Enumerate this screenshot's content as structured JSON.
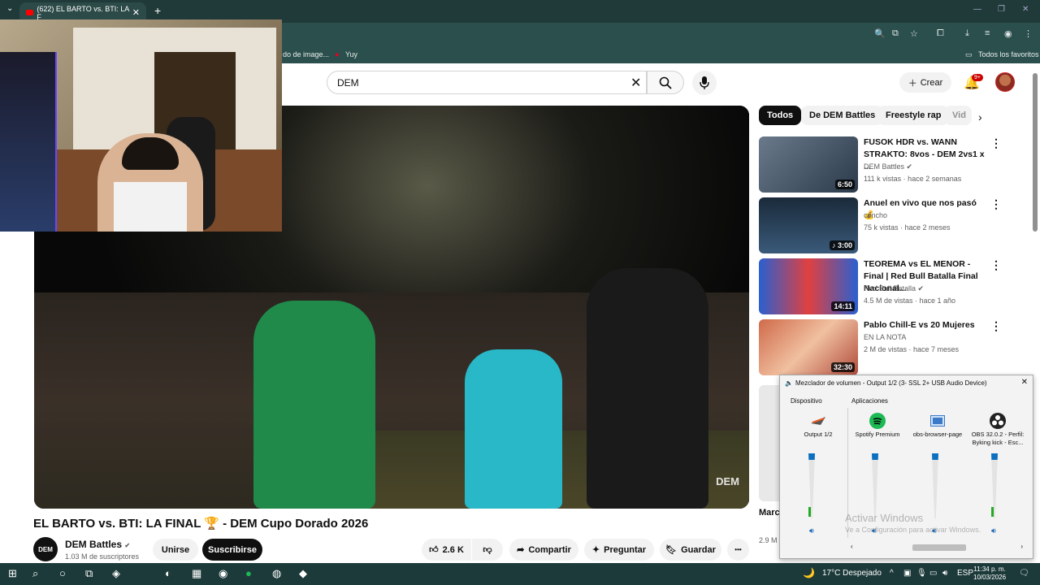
{
  "browser": {
    "tab_title": "(622) EL BARTO vs. BTI: LA F",
    "tab_close": "✕",
    "new_tab": "+",
    "bookmarks": [
      {
        "label": "do de image..."
      },
      {
        "label": "Yuy"
      }
    ],
    "all_bookmarks": "Todos los favoritos"
  },
  "youtube": {
    "search_value": "DEM",
    "search_clear": "✕",
    "create_label": "Crear",
    "notif_count": "9+",
    "video_title": "EL BARTO vs. BTI: LA FINAL 🏆 - DEM Cupo Dorado 2026",
    "video_watermark": "DEM",
    "channel": {
      "avatar_text": "DEM",
      "name": "DEM Battles",
      "verified": "✔",
      "subs": "1.03 M de suscriptores",
      "join_label": "Unirse",
      "subscribe_label": "Suscribirse"
    },
    "actions": {
      "likes": "2.6 K",
      "share": "Compartir",
      "ask": "Preguntar",
      "save": "Guardar",
      "more": "•••"
    },
    "chips": [
      {
        "label": "Todos"
      },
      {
        "label": "De DEM Battles"
      },
      {
        "label": "Freestyle rap"
      },
      {
        "label": "Vid"
      }
    ],
    "recommendations": [
      {
        "title": "FUSOK HDR vs. WANN STRAKTO: 8vos - DEM 2vs1 x ...",
        "channel": "DEM Battles ✔",
        "meta": "111 k vistas · hace 2 semanas",
        "duration": "6:50",
        "thumb_color": "#3a4a5a"
      },
      {
        "title": "Anuel en vivo que nos pasó 💰",
        "channel": "concho",
        "meta": "75 k vistas · hace 2 meses",
        "duration": "♪ 3:00",
        "thumb_color": "#2a3a4a"
      },
      {
        "title": "TEOREMA vs EL MENOR - Final | Red Bull Batalla Final Nacional...",
        "channel": "Red Bull Batalla ✔",
        "meta": "4.5 M de vistas · hace 1 año",
        "duration": "14:11",
        "thumb_color": "#3060c0"
      },
      {
        "title": "Pablo Chill-E vs 20 Mujeres",
        "channel": "EN LA NOTA",
        "meta": "2 M de vistas · hace 7 meses",
        "duration": "32:30",
        "thumb_color": "#c05a40"
      }
    ],
    "partial_title": "Marc v/s ...",
    "partial_views": "2.9 M"
  },
  "mixer": {
    "title": "Mezclador de volumen - Output 1/2 (3- SSL 2+ USB Audio Device)",
    "device_header": "Dispositivo",
    "apps_header": "Aplicaciones",
    "channels": [
      {
        "name": "Output 1/2",
        "icon": "speaker-icon",
        "level": 0.15
      },
      {
        "name": "Spotify Premium",
        "icon": "spotify-icon",
        "level": 0.0
      },
      {
        "name": "obs-browser-page",
        "icon": "window-icon",
        "level": 0.0
      },
      {
        "name": "OBS 32.0.2 - Perfil: Byking kick - Esc...",
        "icon": "obs-icon",
        "level": 0.15
      }
    ],
    "watermark_1": "Activar Windows",
    "watermark_2": "Ve a Configuración para activar Windows."
  },
  "taskbar": {
    "weather": "17°C  Despejado",
    "lang": "ESP",
    "time": "11:34 p. m.",
    "date": "10/03/2026"
  },
  "colors": {
    "youtube_red": "#ff0000",
    "subscribe_bg": "#0f0f0f",
    "mixer_accent": "#0c6fbf"
  }
}
